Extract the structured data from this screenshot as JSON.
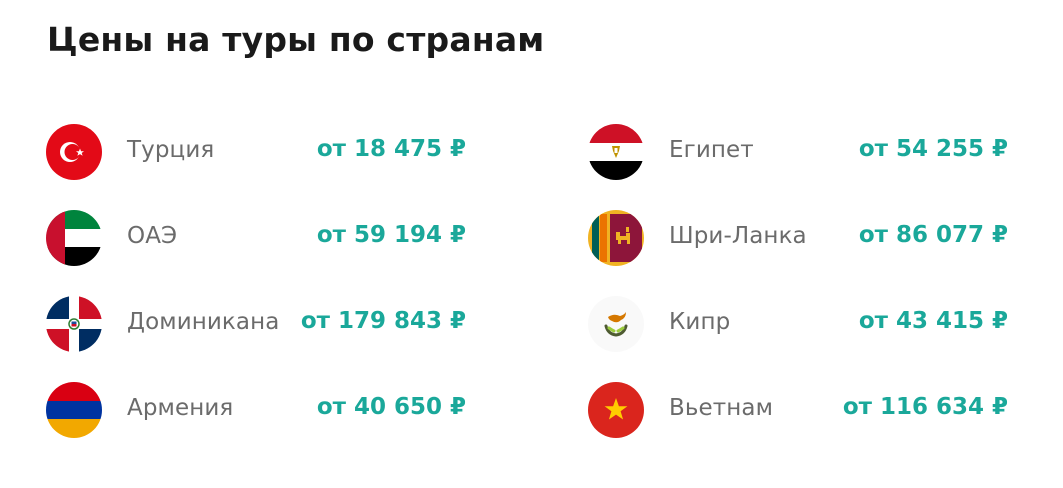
{
  "title": "Цены на туры по странам",
  "accent_color": "#1aa89a",
  "countries": [
    {
      "name": "Турция",
      "price": "от 18 475 ₽",
      "icon": "turkey-flag-icon"
    },
    {
      "name": "ОАЭ",
      "price": "от 59 194 ₽",
      "icon": "uae-flag-icon"
    },
    {
      "name": "Доминикана",
      "price": "от 179 843 ₽",
      "icon": "dominican-republic-flag-icon"
    },
    {
      "name": "Армения",
      "price": "от 40 650 ₽",
      "icon": "armenia-flag-icon"
    },
    {
      "name": "Египет",
      "price": "от 54 255 ₽",
      "icon": "egypt-flag-icon"
    },
    {
      "name": "Шри-Ланка",
      "price": "от 86 077 ₽",
      "icon": "sri-lanka-flag-icon"
    },
    {
      "name": "Кипр",
      "price": "от 43 415 ₽",
      "icon": "cyprus-flag-icon"
    },
    {
      "name": "Вьетнам",
      "price": "от 116 634 ₽",
      "icon": "vietnam-flag-icon"
    }
  ]
}
